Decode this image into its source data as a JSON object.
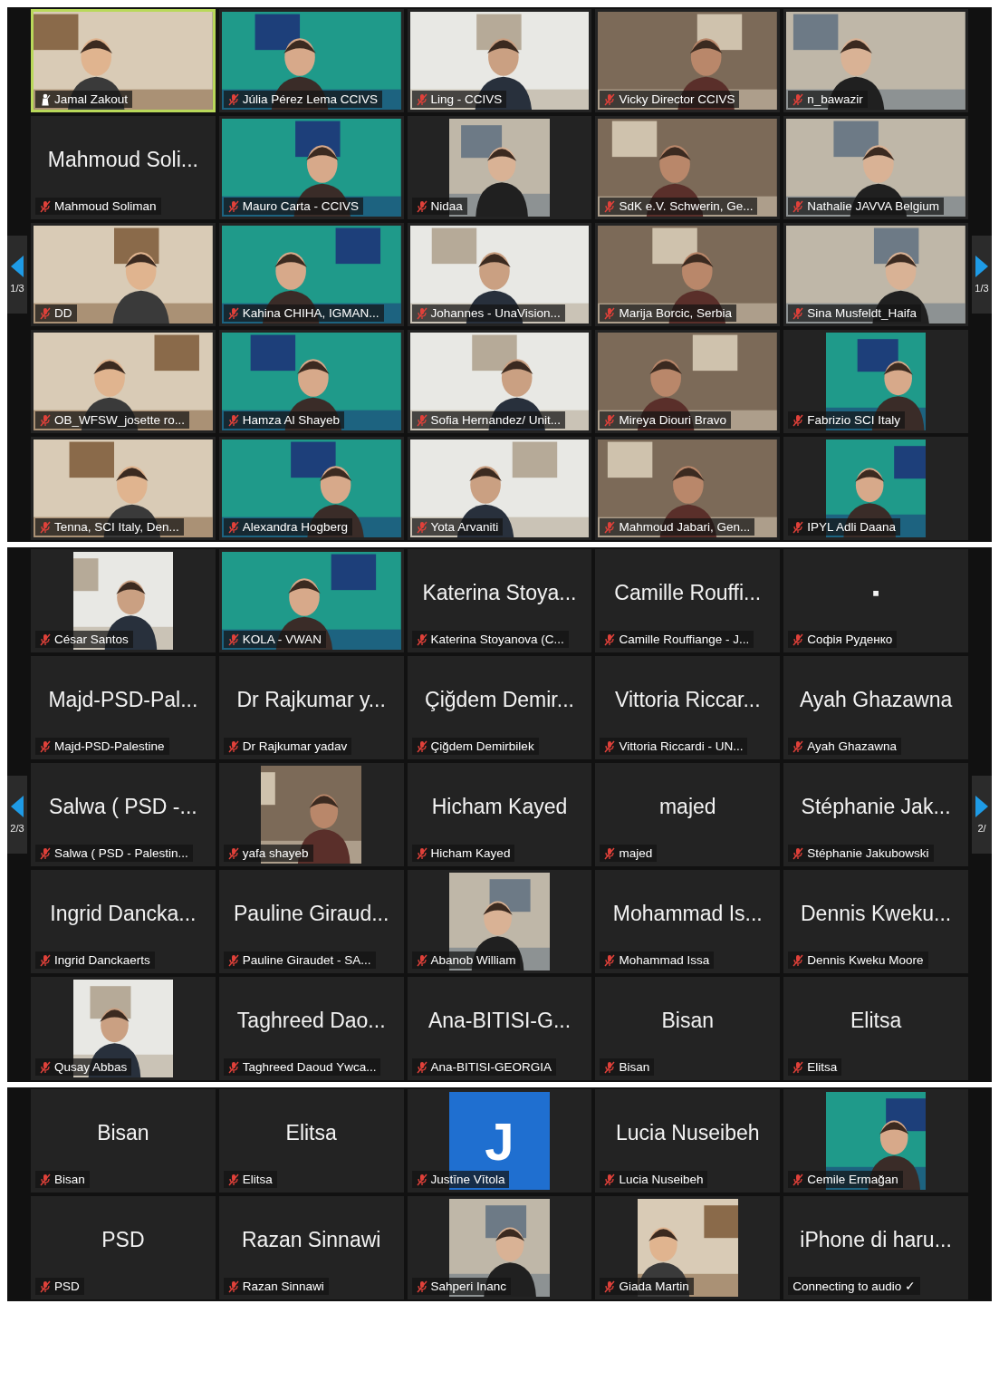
{
  "sections": [
    {
      "page_left": "1/3",
      "page_right": "1/3",
      "tiles": [
        {
          "kind": "video",
          "label": "Jamal Zakout",
          "muted": false,
          "active": true
        },
        {
          "kind": "video",
          "label": "Júlia Pérez Lema CCIVS",
          "muted": true,
          "active": false
        },
        {
          "kind": "video",
          "label": "Ling - CCIVS",
          "muted": true,
          "active": false
        },
        {
          "kind": "video",
          "label": "Vicky Director CCIVS",
          "muted": true,
          "active": false
        },
        {
          "kind": "video",
          "label": "n_bawazir",
          "muted": true,
          "active": false
        },
        {
          "kind": "name",
          "name": "Mahmoud Soli...",
          "label": "Mahmoud Soliman",
          "muted": true,
          "active": false
        },
        {
          "kind": "video",
          "label": "Mauro Carta - CCIVS",
          "muted": true,
          "active": false
        },
        {
          "label": "Nidaa",
          "muted": true,
          "active": false
        },
        {
          "kind": "video",
          "label": "SdK e.V. Schwerin, Ge...",
          "muted": true,
          "active": false
        },
        {
          "kind": "video",
          "label": "Nathalie JAVVA Belgium",
          "muted": true,
          "active": false
        },
        {
          "kind": "video",
          "label": "DD",
          "muted": true,
          "active": false
        },
        {
          "kind": "video",
          "label": "Kahina CHIHA, IGMAN...",
          "muted": true,
          "active": false
        },
        {
          "kind": "video",
          "label": "Johannes - UnaVision...",
          "muted": true,
          "active": false
        },
        {
          "kind": "video",
          "label": "Marija Borcic, Serbia",
          "muted": true,
          "active": false
        },
        {
          "kind": "video",
          "label": "Sina Musfeldt_Haifa",
          "muted": true,
          "active": false
        },
        {
          "kind": "video",
          "label": "OB_WFSW_josette ro...",
          "muted": true,
          "active": false
        },
        {
          "kind": "video",
          "label": "Hamza Al Shayeb",
          "muted": true,
          "active": false
        },
        {
          "kind": "video",
          "label": "Sofia Hernandez/ Unit...",
          "muted": true,
          "active": false
        },
        {
          "kind": "video",
          "label": "Mireya Diouri Bravo",
          "muted": true,
          "active": false
        },
        {
          "label": "Fabrizio SCI Italy",
          "muted": true,
          "active": false
        },
        {
          "kind": "video",
          "label": "Tenna, SCI Italy, Den...",
          "muted": true,
          "active": false
        },
        {
          "kind": "video",
          "label": "Alexandra Hogberg",
          "muted": true,
          "active": false
        },
        {
          "kind": "video",
          "label": "Yota Arvaniti",
          "muted": true,
          "active": false
        },
        {
          "kind": "video",
          "label": "Mahmoud Jabari, Gen...",
          "muted": true,
          "active": false
        },
        {
          "label": "IPYL Adli Daana",
          "muted": true,
          "active": false
        }
      ]
    },
    {
      "page_left": "2/3",
      "page_right": "2/",
      "tiles": [
        {
          "label": "César Santos",
          "muted": true,
          "active": false
        },
        {
          "kind": "video",
          "label": "KOLA - VWAN",
          "muted": true,
          "active": false
        },
        {
          "kind": "name",
          "name": "Katerina Stoya...",
          "label": "Katerina Stoyanova (C...",
          "muted": true,
          "active": false
        },
        {
          "kind": "name",
          "name": "Camille Rouffi...",
          "label": "Camille Rouffiange - J...",
          "muted": true,
          "active": false
        },
        {
          "kind": "name",
          "name": "▪",
          "label": "Софія Руденко",
          "muted": true,
          "active": false
        },
        {
          "kind": "name",
          "name": "Majd-PSD-Pal...",
          "label": "Majd-PSD-Palestine",
          "muted": true,
          "active": false
        },
        {
          "kind": "name",
          "name": "Dr Rajkumar y...",
          "label": "Dr Rajkumar yadav",
          "muted": true,
          "active": false
        },
        {
          "kind": "name",
          "name": "Çiğdem Demir...",
          "label": "Çiğdem Demirbilek",
          "muted": true,
          "active": false
        },
        {
          "kind": "name",
          "name": "Vittoria Riccar...",
          "label": "Vittoria Riccardi - UN...",
          "muted": true,
          "active": false
        },
        {
          "kind": "name",
          "name": "Ayah Ghazawna",
          "label": "Ayah Ghazawna",
          "muted": true,
          "active": false
        },
        {
          "kind": "name",
          "name": "Salwa ( PSD -...",
          "label": "Salwa ( PSD - Palestin...",
          "muted": true,
          "active": false
        },
        {
          "label": "yafa shayeb",
          "muted": true,
          "active": false
        },
        {
          "kind": "name",
          "name": "Hicham Kayed",
          "label": "Hicham Kayed",
          "muted": true,
          "active": false
        },
        {
          "kind": "name",
          "name": "majed",
          "label": "majed",
          "muted": true,
          "active": false
        },
        {
          "kind": "name",
          "name": "Stéphanie Jak...",
          "label": "Stéphanie Jakubowski",
          "muted": true,
          "active": false
        },
        {
          "kind": "name",
          "name": "Ingrid Dancka...",
          "label": "Ingrid Danckaerts",
          "muted": true,
          "active": false
        },
        {
          "kind": "name",
          "name": "Pauline Giraud...",
          "label": "Pauline Giraudet - SA...",
          "muted": true,
          "active": false
        },
        {
          "label": "Abanob William",
          "muted": true,
          "active": false
        },
        {
          "kind": "name",
          "name": "Mohammad Is...",
          "label": "Mohammad Issa",
          "muted": true,
          "active": false
        },
        {
          "kind": "name",
          "name": "Dennis Kweku...",
          "label": "Dennis Kweku Moore",
          "muted": true,
          "active": false
        },
        {
          "label": "Qusay Abbas",
          "muted": true,
          "active": false
        },
        {
          "kind": "name",
          "name": "Taghreed Dao...",
          "label": "Taghreed Daoud Ywca...",
          "muted": true,
          "active": false
        },
        {
          "kind": "name",
          "name": "Ana-BITISI-G...",
          "label": "Ana-BITISI-GEORGIA",
          "muted": true,
          "active": false
        },
        {
          "kind": "name",
          "name": "Bisan",
          "label": "Bisan",
          "muted": true,
          "active": false
        },
        {
          "kind": "name",
          "name": "Elitsa",
          "label": "Elitsa",
          "muted": true,
          "active": false
        }
      ]
    },
    {
      "tiles": [
        {
          "kind": "name",
          "name": "Bisan",
          "label": "Bisan",
          "muted": true,
          "active": false
        },
        {
          "kind": "name",
          "name": "Elitsa",
          "label": "Elitsa",
          "muted": true,
          "active": false
        },
        {
          "kind": "avatar",
          "initial": "J",
          "label": "Justīne Vītola",
          "muted": true,
          "active": false
        },
        {
          "kind": "name",
          "name": "Lucia Nuseibeh",
          "label": "Lucia Nuseibeh",
          "muted": true,
          "active": false
        },
        {
          "label": "Cemile Ermağan",
          "muted": true,
          "active": false
        },
        {
          "kind": "name",
          "name": "PSD",
          "label": "PSD",
          "muted": true,
          "active": false
        },
        {
          "kind": "name",
          "name": "Razan Sinnawi",
          "label": "Razan Sinnawi",
          "muted": true,
          "active": false
        },
        {
          "label": "Sahperi Inanc",
          "muted": true,
          "active": false
        },
        {
          "label": "Giada Martin",
          "muted": true,
          "active": false
        },
        {
          "kind": "name",
          "name": "iPhone di haru...",
          "label": "Connecting to audio ✓",
          "active": false
        }
      ]
    }
  ]
}
